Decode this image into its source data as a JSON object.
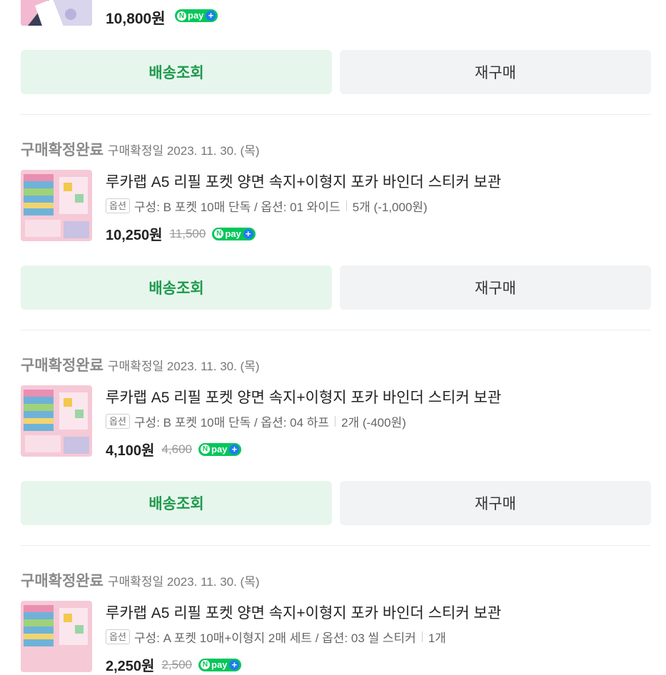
{
  "top_order": {
    "price": "10,800원"
  },
  "npay": {
    "n": "N",
    "label": "pay",
    "plus": "+"
  },
  "buttons": {
    "track": "배송조회",
    "rebuy": "재구매"
  },
  "orders": [
    {
      "status": "구매확정완료",
      "date": "구매확정일 2023. 11. 30. (목)",
      "title": "루카랩 A5 리필 포켓 양면 속지+이형지 포카 바인더 스티커 보관",
      "option_badge": "옵션",
      "option": "구성: B 포켓 10매 단독 / 옵션: 01 와이드",
      "quantity": "5개 (-1,000원)",
      "price": "10,250원",
      "original_price": "11,500"
    },
    {
      "status": "구매확정완료",
      "date": "구매확정일 2023. 11. 30. (목)",
      "title": "루카랩 A5 리필 포켓 양면 속지+이형지 포카 바인더 스티커 보관",
      "option_badge": "옵션",
      "option": "구성: B 포켓 10매 단독 / 옵션: 04 하프",
      "quantity": "2개 (-400원)",
      "price": "4,100원",
      "original_price": "4,600"
    },
    {
      "status": "구매확정완료",
      "date": "구매확정일 2023. 11. 30. (목)",
      "title": "루카랩 A5 리필 포켓 양면 속지+이형지 포카 바인더 스티커 보관",
      "option_badge": "옵션",
      "option": "구성: A 포켓 10매+이형지 2매 세트 / 옵션: 03 씰 스티커",
      "quantity": "1개",
      "price": "2,250원",
      "original_price": "2,500"
    }
  ],
  "colors": {
    "accent_green": "#1f9a4d",
    "track_bg": "#e6f6ec",
    "npay_green": "#03c75a",
    "npay_blue": "#1e7cf2"
  }
}
